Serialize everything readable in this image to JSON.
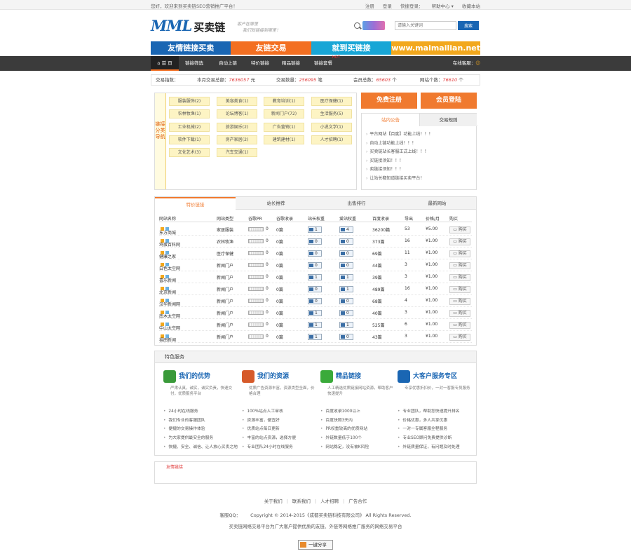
{
  "topbar": {
    "welcome": "您好，欢迎来到买卖链SEO营销推广平台！",
    "links": [
      "注册",
      "登录",
      "快捷登录：",
      "帮助中心 ▾",
      "收藏本站"
    ]
  },
  "logo": {
    "mark": "MML",
    "name": "买卖链"
  },
  "slogan": {
    "line1": "客户在哪里",
    "line2": "我们就链接到哪里！"
  },
  "search": {
    "placeholder": "请输入关键词",
    "button": "搜索"
  },
  "banner": {
    "items": [
      "友情链接买卖",
      "友链交易",
      "就到买链接",
      "www.maimailian.net"
    ],
    "colors": [
      "#1a66b3",
      "#f36f21",
      "#18a6d6",
      "#f2a81d"
    ]
  },
  "nav": {
    "items": [
      "首 页",
      "链接筛选",
      "自动上链",
      "特价链接",
      "精品链接",
      "链接套餐"
    ],
    "hot": "HOT",
    "online": "在线客服："
  },
  "stats": {
    "s1_label": "交易指数：",
    "s2_label": "本月交易总额：",
    "s2_value": "7636057",
    "s2_unit": "元",
    "s3_label": "交易数量：",
    "s3_value": "256095",
    "s3_unit": "笔",
    "s4_label": "会员总数：",
    "s4_value": "65603",
    "s4_unit": "个",
    "s5_label": "网站个数：",
    "s5_value": "76610",
    "s5_unit": "个"
  },
  "categories": {
    "label": "链接分类导航",
    "items": [
      "服装服饰(2)",
      "美容美食(1)",
      "教育培训(1)",
      "医疗保健(1)",
      "农林牧渔(1)",
      "论坛博客(1)",
      "新闻门户(72)",
      "生活服务(5)",
      "工业机械(2)",
      "旅游娱乐(2)",
      "广告营销(1)",
      "小说文学(1)",
      "软件下载(1)",
      "房产家居(2)",
      "建筑建材(1)",
      "人才招聘(1)",
      "文化艺术(3)",
      "汽车交通(1)"
    ]
  },
  "side": {
    "register": "免费注册",
    "login": "会员登陆",
    "tabs": [
      "站内公告",
      "交易规则"
    ],
    "notices": [
      "平台网站【百度】功能上线！！！",
      "自动上链功能上线！！！",
      "买卖链站长客服正式上线！！！",
      "买链接须知！！！",
      "卖链接须知！！！",
      "让站长都知道链接买卖平台！"
    ]
  },
  "list": {
    "tabs": [
      "特价链接",
      "站长推荐",
      "出售排行",
      "最新网站"
    ],
    "headers": [
      "网站名称",
      "网站类型",
      "谷歌PR",
      "谷歌收录",
      "站长权重",
      "爱站权重",
      "百度收录",
      "导出",
      "价格/月",
      "购买"
    ],
    "buy": "购买",
    "rows": [
      {
        "name": "东方商城",
        "type": "家居服装",
        "pr": "0",
        "idx": "0篇",
        "az": "1",
        "w": "4",
        "bd": "36200篇",
        "out": "53",
        "price": "¥5.00"
      },
      {
        "name": "鸡蛋百科网",
        "type": "农林牧渔",
        "pr": "0",
        "idx": "0篇",
        "az": "0",
        "w": "0",
        "bd": "373篇",
        "out": "16",
        "price": "¥1.00"
      },
      {
        "name": "健康之家",
        "type": "医疗保健",
        "pr": "0",
        "idx": "0篇",
        "az": "0",
        "w": "0",
        "bd": "69篇",
        "out": "11",
        "price": "¥1.00"
      },
      {
        "name": "白色太空网",
        "type": "新闻门户",
        "pr": "0",
        "idx": "0篇",
        "az": "0",
        "w": "0",
        "bd": "44篇",
        "out": "3",
        "price": "¥1.00"
      },
      {
        "name": "喜乐新闻",
        "type": "新闻门户",
        "pr": "0",
        "idx": "0篇",
        "az": "1",
        "w": "1",
        "bd": "39篇",
        "out": "3",
        "price": "¥1.00"
      },
      {
        "name": "北京新闻",
        "type": "新闻门户",
        "pr": "0",
        "idx": "0篇",
        "az": "0",
        "w": "1",
        "bd": "489篇",
        "out": "16",
        "price": "¥1.00"
      },
      {
        "name": "汉华新闻网",
        "type": "新闻门户",
        "pr": "0",
        "idx": "0篇",
        "az": "0",
        "w": "0",
        "bd": "68篇",
        "out": "4",
        "price": "¥1.00"
      },
      {
        "name": "南木太空网",
        "type": "新闻门户",
        "pr": "0",
        "idx": "0篇",
        "az": "1",
        "w": "0",
        "bd": "40篇",
        "out": "3",
        "price": "¥1.00"
      },
      {
        "name": "中山太空网",
        "type": "新闻门户",
        "pr": "0",
        "idx": "0篇",
        "az": "1",
        "w": "1",
        "bd": "525篇",
        "out": "6",
        "price": "¥1.00"
      },
      {
        "name": "福田新闻",
        "type": "新闻门户",
        "pr": "0",
        "idx": "0篇",
        "az": "1",
        "w": "0",
        "bd": "43篇",
        "out": "3",
        "price": "¥1.00"
      }
    ]
  },
  "features": {
    "header": "特色服务",
    "cols": [
      {
        "title": "我们的优势",
        "color": "#3a9a3a",
        "desc": "严肃认真，诚实，诚实负责，快速交付，优质服务平台",
        "items": [
          "24小时在线服务",
          "我们专业的客服团队",
          "便捷的交易操作体验",
          "为大家提供最安全的服务",
          "快捷、安全、诚信、让人放心买卖之地"
        ]
      },
      {
        "title": "我们的资源",
        "color": "#d65a2a",
        "desc": "优质广告资源丰富，资源类型全面，价格合理",
        "items": [
          "100%站点人工审核",
          "资源丰富，便宜好",
          "优质站点每日更新",
          "丰富的站点资源，选择方便",
          "专业团队24小时在线服务"
        ]
      },
      {
        "title": "精品链接",
        "color": "#3aaa3a",
        "desc": "人工精选优质链接网站资源，帮助客户快速提升",
        "items": [
          "百度收录1000以上",
          "百度快照3天内",
          "PR权重较高的优质网站",
          "外链数量低于100个",
          "网站稳定，没有被K风险"
        ]
      },
      {
        "title": "大客户服务专区",
        "color": "#1a66b3",
        "desc": "专享优惠折扣价，一对一客服专员服务",
        "items": [
          "专业团队，帮助您快速提升排名",
          "价格优惠，多人共享优惠",
          "一对一专属客服全程服务",
          "专业SEO顾问免费提供诊断",
          "外链质量保证，有问题及时处理"
        ]
      }
    ]
  },
  "friendlinks": {
    "label": "友情链接"
  },
  "footer": {
    "links": [
      "关于我们",
      "联系我们",
      "人才招聘",
      "广告合作"
    ],
    "qq": "客服QQ：",
    "copyright": "Copyright © 2014-2015《成都买卖链科技有限公司》 All Rights Reserved.",
    "desc": "买卖链网络交易平台为广大客户提供优质的友链、外链等网络推广服务的网络交易平台",
    "share": "一键分享"
  }
}
